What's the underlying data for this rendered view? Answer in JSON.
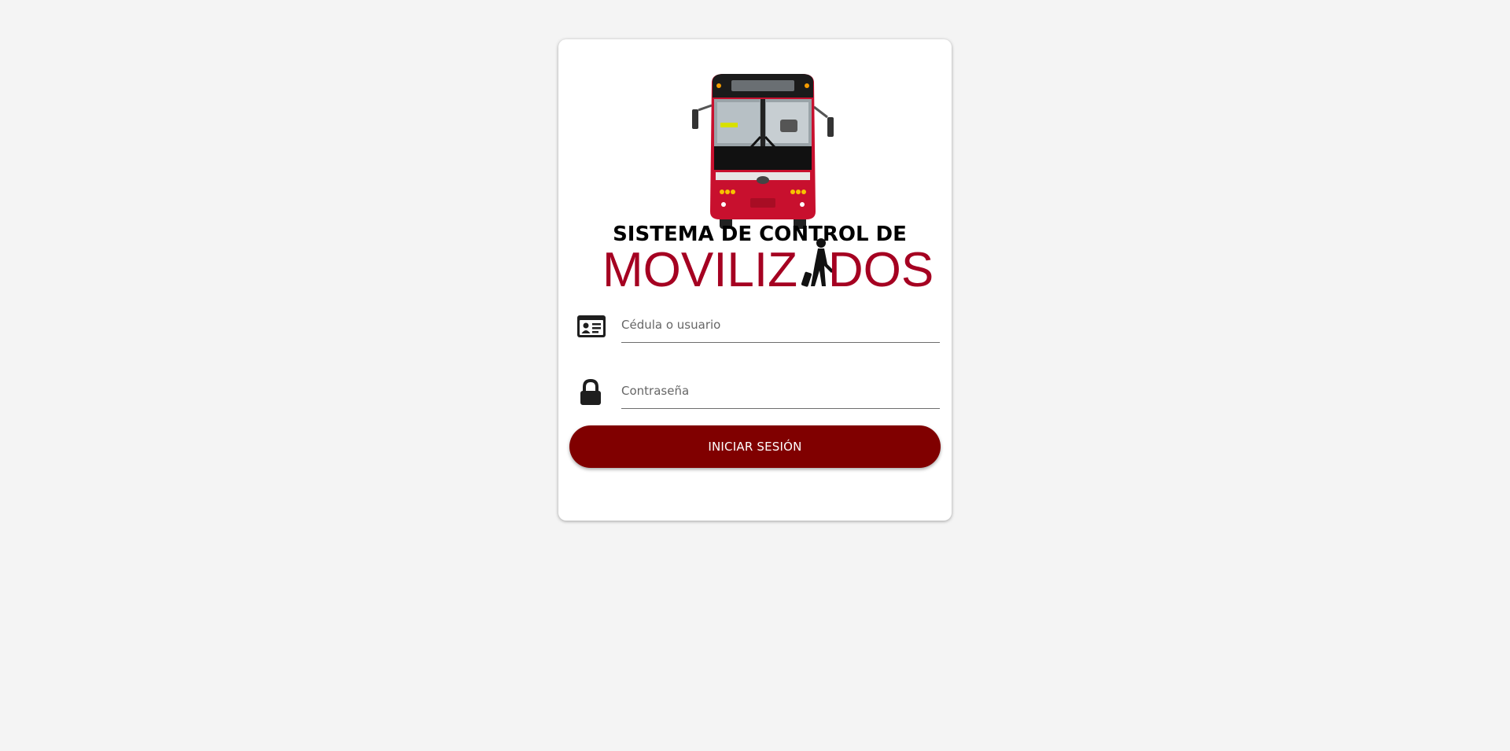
{
  "logo": {
    "line1": "SISTEMA DE CONTROL DE",
    "line2_part1": "MOVILIZ",
    "line2_part2": "DOS",
    "brand_color": "#a50021"
  },
  "form": {
    "username": {
      "placeholder": "Cédula o usuario",
      "value": "",
      "icon": "id-card-icon"
    },
    "password": {
      "placeholder": "Contraseña",
      "value": "",
      "icon": "lock-icon"
    },
    "submit_label": "INICIAR SESIÓN",
    "submit_color": "#800000"
  }
}
